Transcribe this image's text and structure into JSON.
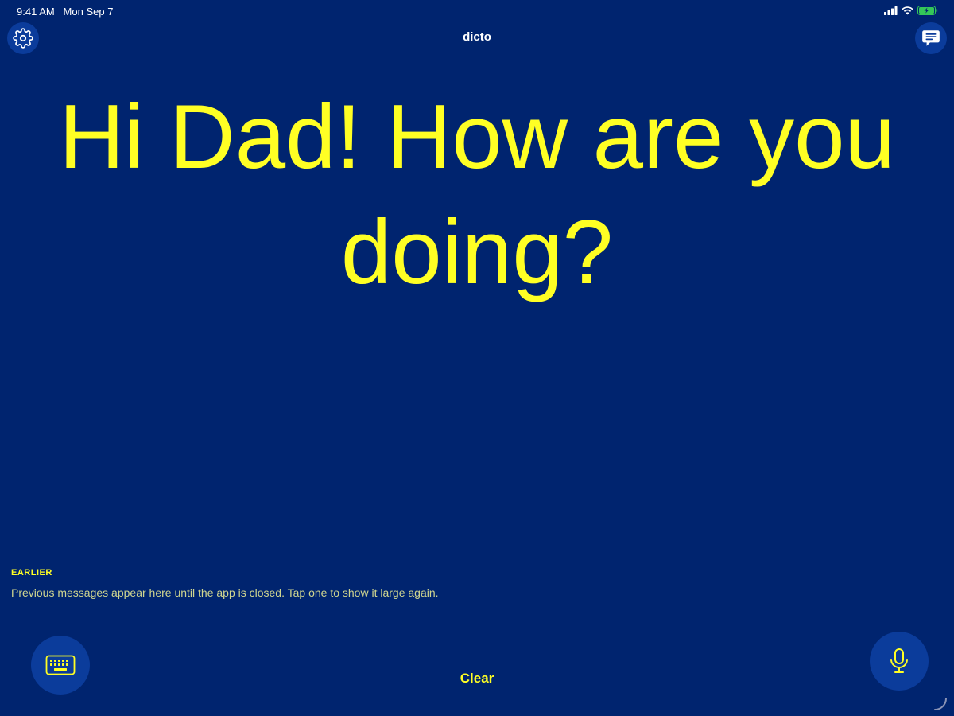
{
  "status_bar": {
    "time": "9:41 AM",
    "date": "Mon Sep 7",
    "icons": [
      "cellular-icon",
      "wifi-icon",
      "battery-charging-icon"
    ]
  },
  "nav": {
    "title": "dicto",
    "left_icon": "gear-icon",
    "right_icon": "message-bubble-icon"
  },
  "main": {
    "message": "Hi Dad! How are you doing?"
  },
  "earlier": {
    "title": "EARLIER",
    "description": "Previous messages appear here until the app is closed. Tap one to show it large again."
  },
  "bottom": {
    "keyboard_icon": "keyboard-icon",
    "clear_label": "Clear",
    "mic_icon": "microphone-icon"
  },
  "colors": {
    "background": "#00246f",
    "accent": "#ffff24",
    "button_bg": "#0b3c9b",
    "battery": "#34c759"
  }
}
